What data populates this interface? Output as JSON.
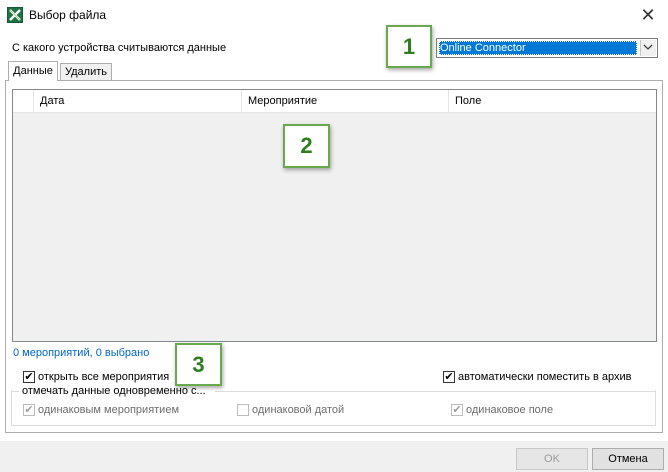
{
  "window": {
    "title": "Выбор файла",
    "close_glyph": "✕",
    "icon": "excel-x-icon"
  },
  "device": {
    "label": "С какого устройства считываются данные",
    "selected": "Online Connector"
  },
  "tabs": [
    {
      "label": "Данные",
      "active": true
    },
    {
      "label": "Удалить",
      "active": false
    }
  ],
  "grid": {
    "columns": [
      "Дата",
      "Мероприятие",
      "Поле"
    ],
    "rows": []
  },
  "summary": "0 мероприятий, 0 выбрано",
  "options": {
    "open_all": {
      "label": "открыть все мероприятия",
      "checked": true
    },
    "auto_archive": {
      "label": "автоматически поместить в архив",
      "checked": true
    },
    "group_label": "отмечать данные одновременно с...",
    "same_event": {
      "label": "одинаковым мероприятием",
      "checked": true,
      "enabled": false
    },
    "same_date": {
      "label": "одинаковой датой",
      "checked": false,
      "enabled": false
    },
    "same_field": {
      "label": "одинаковое поле",
      "checked": true,
      "enabled": false
    }
  },
  "buttons": {
    "ok": "OK",
    "cancel": "Отмена"
  },
  "callouts": [
    "1",
    "2",
    "3"
  ],
  "colors": {
    "selection": "#0078d7",
    "link": "#0066cc",
    "callout_border": "#6aa84f",
    "callout_text": "#2e7d1e"
  }
}
